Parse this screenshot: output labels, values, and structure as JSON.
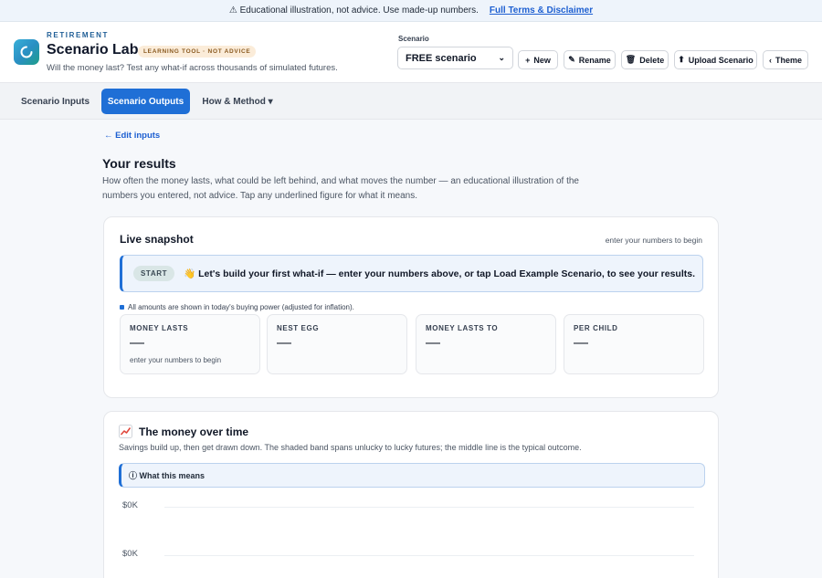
{
  "banner": {
    "text": "⚠ Educational illustration, not advice. Use made-up numbers.",
    "link": "Full Terms & Disclaimer"
  },
  "header": {
    "kicker": "RETIREMENT",
    "title": "Scenario Lab.",
    "badge": "LEARNING TOOL · NOT ADVICE",
    "tagline": "Will the money last? Test any what-if across thousands of simulated futures."
  },
  "scenario": {
    "label": "Scenario",
    "selected": "FREE scenario",
    "buttons": {
      "new": "New",
      "rename": "Rename",
      "delete": "Delete",
      "upload": "Upload Scenario",
      "theme": "Theme"
    }
  },
  "tabs": [
    "Scenario Inputs",
    "Scenario Outputs",
    "How & Method ▾"
  ],
  "main": {
    "edit_link": "← Edit inputs",
    "heading": "Your results",
    "intro": "How often the money lasts, what could be left behind, and what moves the number — an educational illustration of the numbers you entered, not advice. Tap any underlined figure for what it means."
  },
  "snapshot": {
    "title": "Live snapshot",
    "status": "enter your numbers to begin",
    "pill": "START",
    "callout": "👋 Let's build your first what-if — enter your numbers above, or tap Load Example Scenario, to see your results.",
    "inflation_note": "All amounts are shown in today's buying power (adjusted for inflation).",
    "stats": [
      {
        "label": "MONEY LASTS",
        "value": "—",
        "sub": "enter your numbers to begin"
      },
      {
        "label": "NEST EGG",
        "value": "—",
        "sub": ""
      },
      {
        "label": "MONEY LASTS TO",
        "value": "—",
        "sub": ""
      },
      {
        "label": "PER CHILD",
        "value": "—",
        "sub": ""
      }
    ]
  },
  "money_over_time": {
    "title": "The money over time",
    "subtitle": "Savings build up, then get drawn down. The shaded band spans unlucky to lucky futures; the middle line is the typical outcome.",
    "what_this_means": "ⓘ What this means",
    "y_ticks": [
      "$0K",
      "$0K"
    ]
  }
}
